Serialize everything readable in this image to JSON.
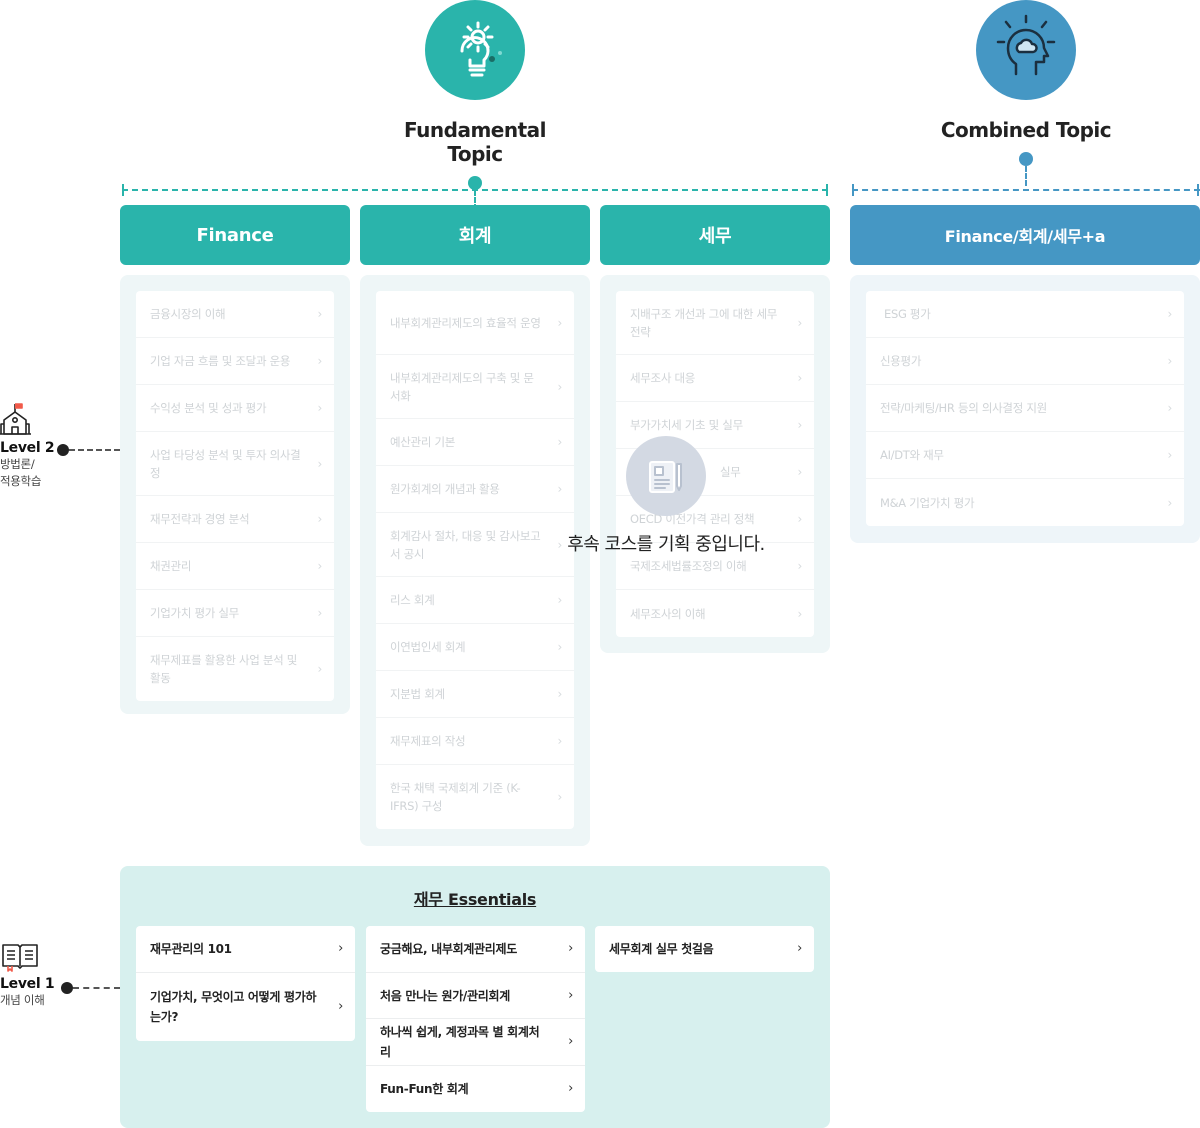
{
  "topics": {
    "fundamental": {
      "title": "Fundamental Topic",
      "icon": "lightbulb-gear-icon",
      "color": "#2ab4ab"
    },
    "combined": {
      "title": "Combined Topic",
      "icon": "head-idea-icon",
      "color": "#4597c4"
    }
  },
  "columns": {
    "finance": {
      "header": "Finance",
      "items": [
        "금융시장의 이해",
        "기업 자금 흐름 및 조달과 운용",
        "수익성 분석 및 성과 평가",
        "사업 타당성 분석 및 투자 의사결정",
        "재무전략과 경영 분석",
        "채권관리",
        "기업가치 평가 실무",
        "재무제표를 활용한 사업 분석 및 활동"
      ]
    },
    "accounting": {
      "header": "회계",
      "items": [
        "내부회계관리제도의 효율적 운영",
        "내부회계관리제도의 구축 및 문서화",
        "예산관리 기본",
        "원가회계의 개념과 활용",
        "회계감사 절차, 대응 및 감사보고서 공시",
        "리스 회계",
        "이연법인세 회계",
        "지분법 회계",
        "재무제표의 작성",
        "한국 채택 국제회계 기준 (K-IFRS) 구성"
      ]
    },
    "tax": {
      "header": "세무",
      "items": [
        "지배구조 개선과 그에 대한 세무전략",
        "세무조사 대응",
        "부가가치세 기초 및 실무",
        "실무",
        "OECD 이전가격 관리 정책",
        "국제조세법률조정의 이해",
        "세무조사의 이해"
      ]
    },
    "combined": {
      "header": "Finance/회계/세무+a",
      "items": [
        "ESG 평가",
        "신용평가",
        "전략/마케팅/HR 등의 의사결정 지원",
        "AI/DT와 재무",
        "M&A 기업가치 평가"
      ]
    }
  },
  "overlay": {
    "message": "후속 코스를 기획 중입니다.",
    "icon": "document-edit-icon"
  },
  "levels": {
    "level2": {
      "title": "Level 2",
      "sub1": "방법론/",
      "sub2": "적용학습",
      "icon": "school-icon"
    },
    "level1": {
      "title": "Level 1",
      "sub1": "개념 이해",
      "icon": "open-book-icon"
    }
  },
  "essentials": {
    "title": "재무 Essentials",
    "col1": [
      "재무관리의 101",
      "기업가치, 무엇이고 어떻게 평가하는가?"
    ],
    "col2": [
      "궁금해요, 내부회계관리제도",
      "처음 만나는 원가/관리회계",
      "하나씩 쉽게, 계정과목 별 회계처리",
      "Fun-Fun한 회계"
    ],
    "col3": [
      "세무회계 실무 첫걸음"
    ]
  },
  "colors": {
    "green": "#2ab4ab",
    "blue": "#4597c4",
    "essentialsBg": "#d7f0ee"
  }
}
